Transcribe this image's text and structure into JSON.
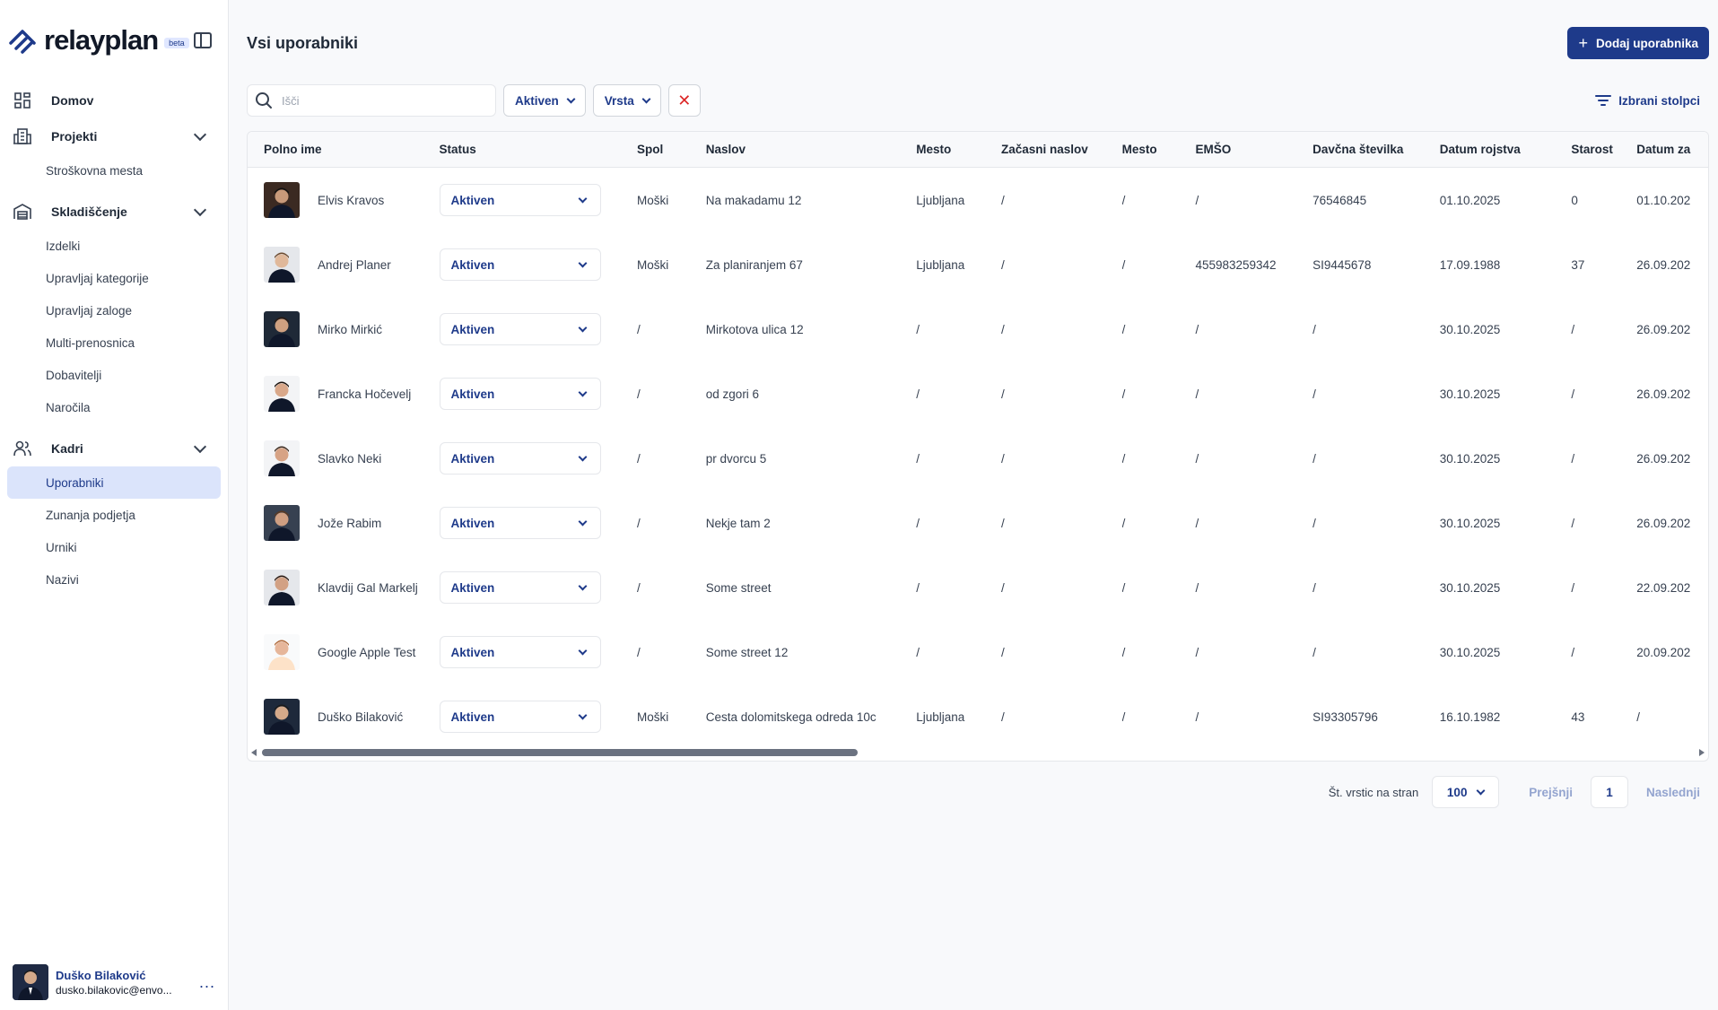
{
  "app": {
    "brand_name": "relayplan",
    "beta_label": "beta"
  },
  "sidebar": {
    "groups": [
      {
        "label": "Domov",
        "icon": "grid-icon",
        "expandable": false,
        "items": []
      },
      {
        "label": "Projekti",
        "icon": "building-icon",
        "expandable": true,
        "items": [
          "Stroškovna mesta"
        ]
      },
      {
        "label": "Skladiščenje",
        "icon": "warehouse-icon",
        "expandable": true,
        "items": [
          "Izdelki",
          "Upravljaj kategorije",
          "Upravljaj zaloge",
          "Multi-prenosnica",
          "Dobavitelji",
          "Naročila"
        ]
      },
      {
        "label": "Kadri",
        "icon": "users-icon",
        "expandable": true,
        "items": [
          "Uporabniki",
          "Zunanja podjetja",
          "Urniki",
          "Nazivi"
        ]
      }
    ],
    "active_item": "Uporabniki",
    "user": {
      "name": "Duško Bilaković",
      "email": "dusko.bilakovic@envo...",
      "more": "..."
    }
  },
  "header": {
    "title": "Vsi uporabniki",
    "add_button": "Dodaj uporabnika"
  },
  "filters": {
    "search_placeholder": "Išči",
    "status_chip": "Aktiven",
    "type_chip": "Vrsta",
    "columns_button": "Izbrani stolpci"
  },
  "table": {
    "columns": [
      "Polno ime",
      "Status",
      "Spol",
      "Naslov",
      "Mesto",
      "Začasni naslov",
      "Mesto",
      "EMŠO",
      "Davčna številka",
      "Datum rojstva",
      "Starost",
      "Datum za"
    ],
    "rows": [
      {
        "name": "Elvis Kravos",
        "status": "Aktiven",
        "gender": "Moški",
        "address": "Na makadamu 12",
        "city": "Ljubljana",
        "temp_address": "/",
        "temp_city": "/",
        "emso": "/",
        "tax": "76546845",
        "birth": "01.10.2025",
        "age": "0",
        "date": "01.10.202"
      },
      {
        "name": "Andrej Planer",
        "status": "Aktiven",
        "gender": "Moški",
        "address": "Za planiranjem 67",
        "city": "Ljubljana",
        "temp_address": "/",
        "temp_city": "/",
        "emso": "455983259342",
        "tax": "SI9445678",
        "birth": "17.09.1988",
        "age": "37",
        "date": "26.09.202"
      },
      {
        "name": "Mirko Mirkić",
        "status": "Aktiven",
        "gender": "/",
        "address": "Mirkotova ulica 12",
        "city": "/",
        "temp_address": "/",
        "temp_city": "/",
        "emso": "/",
        "tax": "/",
        "birth": "30.10.2025",
        "age": "/",
        "date": "26.09.202"
      },
      {
        "name": "Francka Hočevelj",
        "status": "Aktiven",
        "gender": "/",
        "address": "od zgori 6",
        "city": "/",
        "temp_address": "/",
        "temp_city": "/",
        "emso": "/",
        "tax": "/",
        "birth": "30.10.2025",
        "age": "/",
        "date": "26.09.202"
      },
      {
        "name": "Slavko Neki",
        "status": "Aktiven",
        "gender": "/",
        "address": "pr dvorcu 5",
        "city": "/",
        "temp_address": "/",
        "temp_city": "/",
        "emso": "/",
        "tax": "/",
        "birth": "30.10.2025",
        "age": "/",
        "date": "26.09.202"
      },
      {
        "name": "Jože Rabim",
        "status": "Aktiven",
        "gender": "/",
        "address": "Nekje tam 2",
        "city": "/",
        "temp_address": "/",
        "temp_city": "/",
        "emso": "/",
        "tax": "/",
        "birth": "30.10.2025",
        "age": "/",
        "date": "26.09.202"
      },
      {
        "name": "Klavdij Gal Markelj",
        "status": "Aktiven",
        "gender": "/",
        "address": "Some street",
        "city": "/",
        "temp_address": "/",
        "temp_city": "/",
        "emso": "/",
        "tax": "/",
        "birth": "30.10.2025",
        "age": "/",
        "date": "22.09.202"
      },
      {
        "name": "Google Apple Test",
        "status": "Aktiven",
        "gender": "/",
        "address": "Some street 12",
        "city": "/",
        "temp_address": "/",
        "temp_city": "/",
        "emso": "/",
        "tax": "/",
        "birth": "30.10.2025",
        "age": "/",
        "date": "20.09.202"
      },
      {
        "name": "Duško Bilaković",
        "status": "Aktiven",
        "gender": "Moški",
        "address": "Cesta dolomitskega odreda 10c",
        "city": "Ljubljana",
        "temp_address": "/",
        "temp_city": "/",
        "emso": "/",
        "tax": "SI93305796",
        "birth": "16.10.1982",
        "age": "43",
        "date": "/"
      }
    ]
  },
  "pagination": {
    "rows_per_page_label": "Št. vrstic na stran",
    "rows_per_page": "100",
    "prev": "Prejšnji",
    "page": "1",
    "next": "Naslednji"
  },
  "colors": {
    "primary": "#1e3a8a",
    "active_nav_bg": "#dbe4fb",
    "clear_icon": "#dc2626"
  }
}
